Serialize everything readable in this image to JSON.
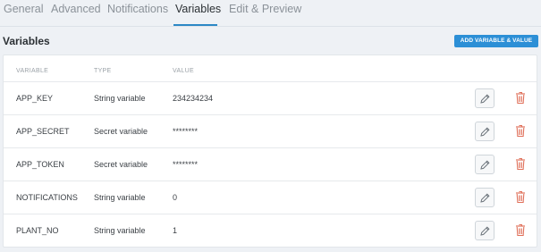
{
  "tabs": [
    {
      "label": "General"
    },
    {
      "label": "Advanced"
    },
    {
      "label": "Notifications"
    },
    {
      "label": "Variables"
    },
    {
      "label": "Edit & Preview"
    }
  ],
  "active_tab": "Variables",
  "section": {
    "title": "Variables",
    "add_button_label": "ADD VARIABLE & VALUE"
  },
  "table": {
    "columns": {
      "variable": "VARIABLE",
      "type": "TYPE",
      "value": "VALUE"
    },
    "rows": [
      {
        "name": "APP_KEY",
        "type": "String variable",
        "value": "234234234"
      },
      {
        "name": "APP_SECRET",
        "type": "Secret variable",
        "value": "********"
      },
      {
        "name": "APP_TOKEN",
        "type": "Secret variable",
        "value": "********"
      },
      {
        "name": "NOTIFICATIONS",
        "type": "String variable",
        "value": "0"
      },
      {
        "name": "PLANT_NO",
        "type": "String variable",
        "value": "1"
      }
    ]
  },
  "icons": {
    "edit": "pencil-icon",
    "delete": "trash-icon"
  },
  "colors": {
    "accent": "#2c88c5",
    "button": "#2c8fd6",
    "delete": "#e0705a"
  }
}
